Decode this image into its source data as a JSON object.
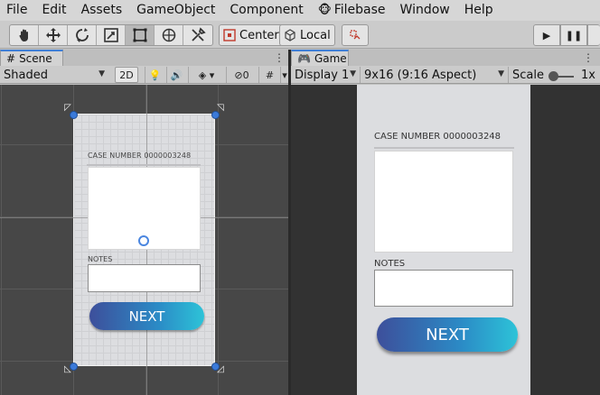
{
  "menu": {
    "items": [
      "File",
      "Edit",
      "Assets",
      "GameObject",
      "Component",
      "Filebase",
      "Window",
      "Help"
    ],
    "filebase_icon": "monkey-icon"
  },
  "toolbar": {
    "tools": [
      "hand-icon",
      "move-icon",
      "rotate-icon",
      "scale-icon",
      "rect-icon",
      "transform-icon",
      "custom-tool-icon"
    ],
    "active_tool": "rect-icon",
    "pivot_label": "Center",
    "space_label": "Local",
    "play_icons": [
      "play-icon",
      "pause-icon"
    ]
  },
  "scene_panel": {
    "tab_label": "Scene",
    "tab_icon": "scene-grid-icon",
    "shading_mode": "Shaded",
    "mode_2d_label": "2D",
    "hidden_count": "0"
  },
  "game_panel": {
    "tab_label": "Game",
    "tab_icon": "gamepad-icon",
    "display": "Display 1",
    "aspect": "9x16 (9:16 Aspect)",
    "scale_label": "Scale",
    "scale_value": "1x",
    "scale_slider_fraction": 0.1
  },
  "app_ui": {
    "case_number": "CASE NUMBER 0000003248",
    "notes_label": "NOTES",
    "next_label": "NEXT"
  },
  "colors": {
    "next_gradient_start": "#3d4f9b",
    "next_gradient_end": "#2dc3d8",
    "selection_handle": "#3b7ad9"
  }
}
